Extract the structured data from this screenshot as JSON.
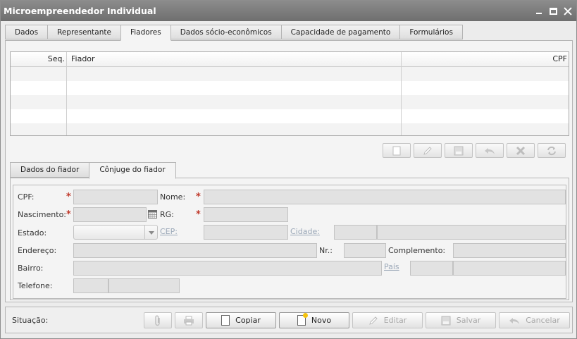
{
  "window": {
    "title": "Microempreendedor Individual"
  },
  "tabs": [
    {
      "label": "Dados"
    },
    {
      "label": "Representante"
    },
    {
      "label": "Fiadores"
    },
    {
      "label": "Dados sócio-econômicos"
    },
    {
      "label": "Capacidade de pagamento"
    },
    {
      "label": "Formulários"
    }
  ],
  "active_tab": "Fiadores",
  "grid": {
    "columns": [
      {
        "label": "Seq."
      },
      {
        "label": "Fiador"
      },
      {
        "label": "CPF"
      }
    ],
    "rows": []
  },
  "subtabs": [
    {
      "label": "Dados do fiador"
    },
    {
      "label": "Cônjuge do fiador"
    }
  ],
  "active_subtab": "Cônjuge do fiador",
  "form": {
    "cpf_label": "CPF:",
    "nome_label": "Nome:",
    "nascimento_label": "Nascimento:",
    "rg_label": "RG:",
    "estado_label": "Estado:",
    "cep_label": "CEP:",
    "cidade_label": "Cidade:",
    "endereco_label": "Endereço:",
    "nr_label": "Nr.:",
    "complemento_label": "Complemento:",
    "bairro_label": "Bairro:",
    "pais_label": "País",
    "telefone_label": "Telefone:",
    "required_mark": "*"
  },
  "footer": {
    "status_label": "Situação:",
    "copiar_label": "Copiar",
    "novo_label": "Novo",
    "editar_label": "Editar",
    "salvar_label": "Salvar",
    "cancelar_label": "Cancelar"
  }
}
